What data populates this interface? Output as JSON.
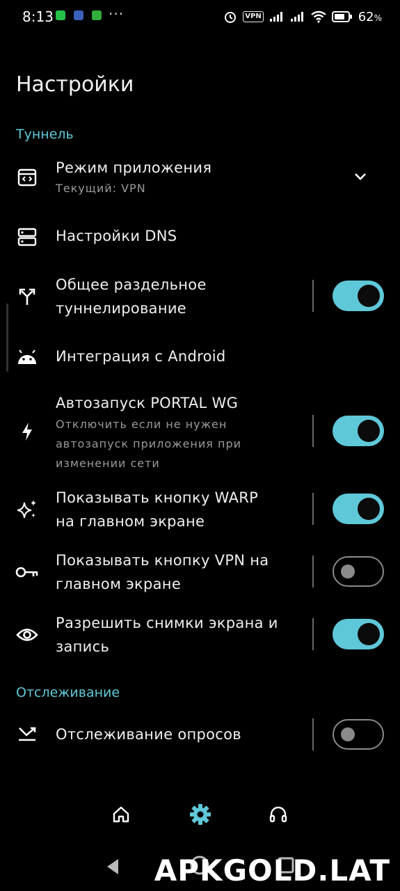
{
  "status_bar": {
    "time": "8:13",
    "dots": "···",
    "vpn_badge": "VPN",
    "battery": "62",
    "battery_unit": "%"
  },
  "page": {
    "title": "Настройки"
  },
  "sections": {
    "tunnel": "Туннель",
    "tracking": "Отслеживание"
  },
  "rows": {
    "app_mode": {
      "title": "Режим приложения",
      "subtitle": "Текущий: VPN",
      "icon": "app-window-icon"
    },
    "dns": {
      "title": "Настройки DNS",
      "icon": "dns-server-icon"
    },
    "split_tunnel": {
      "title_line1": "Общее раздельное",
      "title_line2": "туннелирование",
      "icon": "split-arrows-icon",
      "enabled": true
    },
    "android": {
      "title": "Интеграция с Android",
      "icon": "android-icon"
    },
    "autostart": {
      "title": "Автозапуск PORTAL WG",
      "sub_line1": "Отключить если не нужен",
      "sub_line2": "автозапуск приложения при",
      "sub_line3": "изменении сети",
      "icon": "bolt-icon",
      "enabled": true
    },
    "warp_button": {
      "title_line1": "Показывать кнопку WARP",
      "title_line2": "на главном экране",
      "icon": "sparkles-icon",
      "enabled": true
    },
    "vpn_button": {
      "title_line1": "Показывать кнопку VPN на",
      "title_line2": "главном экране",
      "icon": "key-icon",
      "enabled": false
    },
    "screenshots": {
      "title_line1": "Разрешить снимки экрана и",
      "title_line2": "запись",
      "icon": "eye-icon",
      "enabled": true
    },
    "poll_tracking": {
      "title": "Отслеживание опросов",
      "icon": "poll-arrow-icon",
      "enabled": false
    }
  },
  "bottom_nav": {
    "items": [
      "home-icon",
      "settings-icon",
      "support-headset-icon"
    ],
    "active": "settings-icon"
  },
  "watermark": "APKGOLD.LAT",
  "colors": {
    "accent": "#5fc8d8",
    "background": "#000000",
    "subtitle": "#9a9a9a"
  }
}
